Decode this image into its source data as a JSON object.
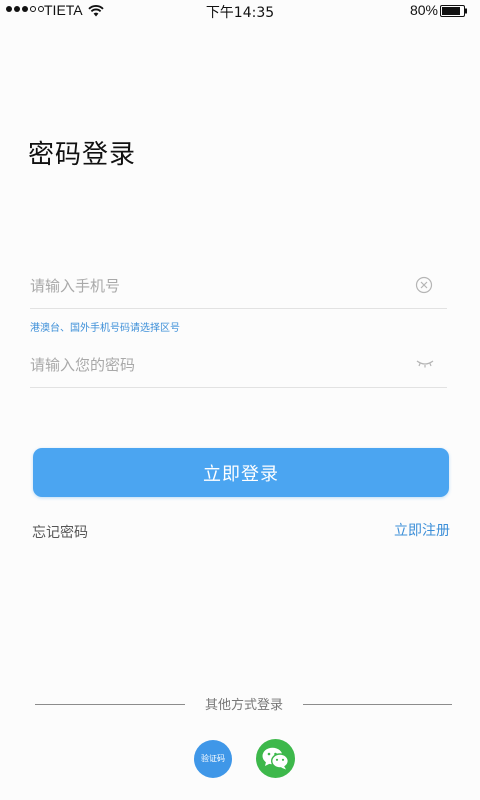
{
  "status_bar": {
    "carrier": "TIETA",
    "time": "下午14:35",
    "battery": "80%"
  },
  "title": "密码登录",
  "phone_field": {
    "placeholder": "请输入手机号",
    "hint": "港澳台、国外手机号码请选择区号"
  },
  "password_field": {
    "placeholder": "请输入您的密码"
  },
  "login_button": "立即登录",
  "links": {
    "forgot": "忘记密码",
    "register": "立即注册"
  },
  "other_methods": {
    "label": "其他方式登录",
    "sms_label": "验证码"
  },
  "colors": {
    "accent": "#4ba5f1",
    "link": "#3d8fd8",
    "wechat": "#3db84b"
  },
  "icons": [
    "wifi-icon",
    "battery-icon",
    "clear-icon",
    "eye-closed-icon",
    "wechat-icon"
  ]
}
